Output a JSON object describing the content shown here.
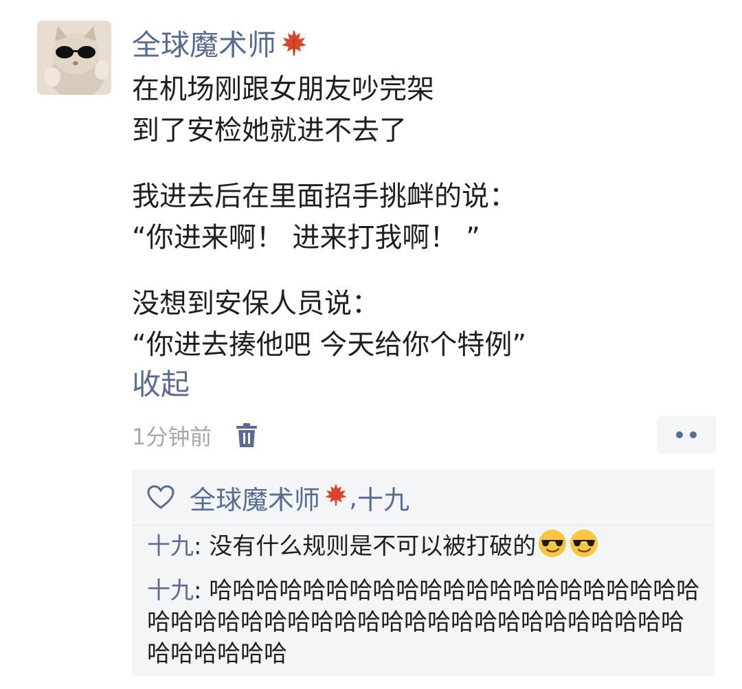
{
  "post": {
    "author": "全球魔术师",
    "lines_1": [
      "在机场刚跟女朋友吵完架",
      "到了安检她就进不去了"
    ],
    "lines_2": [
      "我进去后在里面招手挑衅的说：",
      "“你进来啊！ 进来打我啊！ ”"
    ],
    "lines_3": [
      "没想到安保人员说：",
      "“你进去揍他吧 今天给你个特例”"
    ],
    "collapse_label": "收起",
    "time": "1分钟前",
    "icons": {
      "author_badge": "maple-leaf-icon",
      "delete": "trash-icon",
      "more": "more-dots-icon",
      "like": "heart-icon",
      "emoji": "sunglasses-emoji-icon"
    }
  },
  "likes": {
    "names": [
      "全球魔术师",
      "十九"
    ],
    "separator": ", "
  },
  "comments": [
    {
      "name": "十九",
      "sep": ": ",
      "text": "没有什么规则是不可以被打破的",
      "emoji_count": 2
    },
    {
      "name": "十九",
      "sep": ": ",
      "text": "哈哈哈哈哈哈哈哈哈哈哈哈哈哈哈哈哈哈哈哈哈哈哈哈哈哈哈哈哈哈哈哈哈哈哈哈哈哈哈哈哈哈哈哈哈哈哈哈哈哈",
      "emoji_count": 0
    }
  ],
  "colors": {
    "link": "#576b95",
    "text": "#1f1f1f",
    "muted": "#a8a8a8",
    "panel": "#f4f5f7",
    "leaf": "#d9462b"
  }
}
